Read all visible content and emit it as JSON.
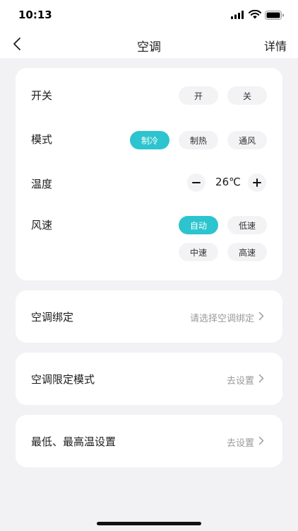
{
  "status": {
    "time": "10:13"
  },
  "nav": {
    "title": "空调",
    "details_label": "详情"
  },
  "controls": {
    "power": {
      "label": "开关",
      "options": [
        "开",
        "关"
      ]
    },
    "mode": {
      "label": "模式",
      "options": [
        "制冷",
        "制热",
        "通风"
      ],
      "selected": "制冷"
    },
    "temperature": {
      "label": "温度",
      "value": "26℃"
    },
    "fan": {
      "label": "风速",
      "options": [
        "自动",
        "低速",
        "中速",
        "高速"
      ],
      "selected": "自动"
    }
  },
  "links": [
    {
      "label": "空调绑定",
      "value": "请选择空调绑定"
    },
    {
      "label": "空调限定模式",
      "value": "去设置"
    },
    {
      "label": "最低、最高温设置",
      "value": "去设置"
    }
  ],
  "colors": {
    "accent": "#2cc4cf",
    "background": "#f2f2f4",
    "card": "#ffffff",
    "muted_text": "#9a9a9e"
  }
}
